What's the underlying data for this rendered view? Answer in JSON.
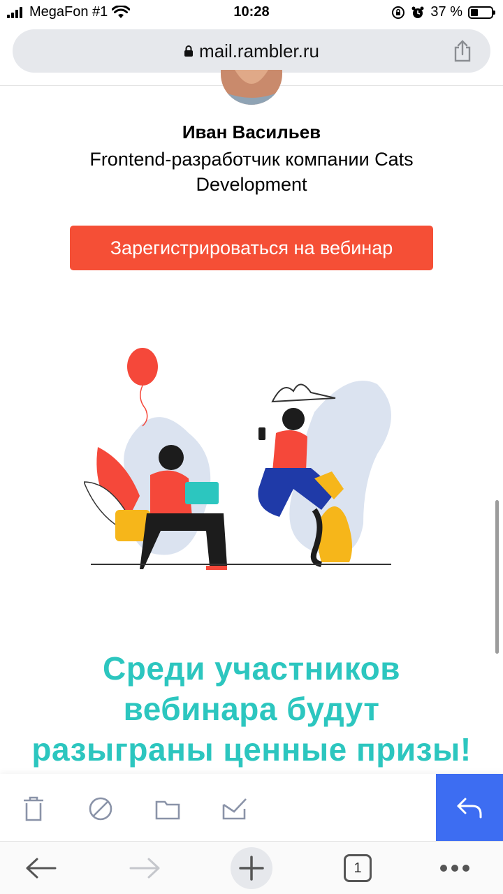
{
  "status_bar": {
    "carrier": "MegaFon #1",
    "time": "10:28",
    "battery_percent": "37 %",
    "battery_level": 0.37
  },
  "url_bar": {
    "url": "mail.rambler.ru",
    "lock_icon": "lock-icon",
    "share_icon": "share-icon"
  },
  "speaker": {
    "name": "Иван Васильев",
    "role": "Frontend-разработчик компании Cats Development"
  },
  "register_button": {
    "label": "Зарегистрироваться на вебинар",
    "color": "#f54f36"
  },
  "prize_text": {
    "line1": "Среди участников",
    "line2": "вебинара будут",
    "line3": "разыграны ценные призы!",
    "color": "#2cc6bf"
  },
  "mail_toolbar": {
    "icons": [
      "trash-icon",
      "block-icon",
      "folder-icon",
      "mark-read-icon"
    ],
    "reply_icon": "reply-icon",
    "reply_color": "#3d6df2"
  },
  "browser_bar": {
    "tab_count": "1",
    "icons": [
      "back-arrow-icon",
      "forward-arrow-icon",
      "new-tab-icon",
      "tabs-icon",
      "more-icon"
    ]
  }
}
